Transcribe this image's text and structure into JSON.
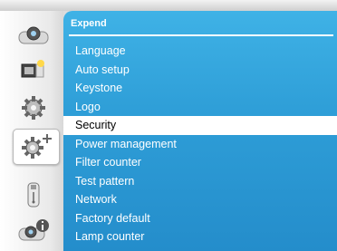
{
  "panel": {
    "title": "Expend"
  },
  "menu": {
    "items": [
      {
        "label": "Language"
      },
      {
        "label": "Auto setup"
      },
      {
        "label": "Keystone"
      },
      {
        "label": "Logo"
      },
      {
        "label": "Security",
        "selected": true
      },
      {
        "label": "Power management"
      },
      {
        "label": "Filter counter"
      },
      {
        "label": "Test pattern"
      },
      {
        "label": "Network"
      },
      {
        "label": "Factory default"
      },
      {
        "label": "Lamp counter"
      }
    ]
  },
  "sidebar": {
    "icons": [
      {
        "name": "projector-icon"
      },
      {
        "name": "image-adjust-icon"
      },
      {
        "name": "gear-icon"
      },
      {
        "name": "gear-plus-icon",
        "active": true
      },
      {
        "name": "usb-icon"
      },
      {
        "name": "projector-info-icon"
      }
    ]
  },
  "colors": {
    "panel_blue": "#2f9fd8",
    "selected_bg": "#ffffff",
    "text": "#ffffff"
  }
}
